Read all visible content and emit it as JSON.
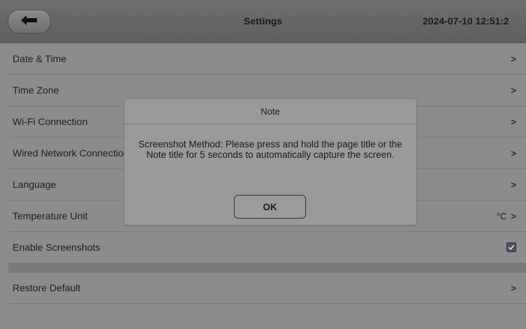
{
  "header": {
    "title": "Settings",
    "datetime": "2024-07-10 12:51:2",
    "back_icon": "back-arrow-icon"
  },
  "settings": [
    {
      "label": "Date & Time",
      "right": "",
      "control": "chevron"
    },
    {
      "label": "Time Zone",
      "right": "",
      "control": "chevron"
    },
    {
      "label": "Wi-Fi Connection",
      "right": "",
      "control": "chevron"
    },
    {
      "label": "Wired Network Connection",
      "right": "",
      "control": "chevron"
    },
    {
      "label": "Language",
      "right": "",
      "control": "chevron"
    },
    {
      "label": "Temperature Unit",
      "right": "°C",
      "control": "chevron"
    },
    {
      "label": "Enable Screenshots",
      "right": "",
      "control": "checkbox",
      "checked": true
    }
  ],
  "settings_group2": [
    {
      "label": "Restore Default",
      "control": "chevron"
    }
  ],
  "chevron": ">",
  "dialog": {
    "title": "Note",
    "message": "Screenshot Method: Please press and hold the page title or the Note title for 5 seconds to automatically capture the screen.",
    "ok_label": "OK"
  },
  "colors": {
    "background": "#8c8c8c",
    "topbar": "#666666",
    "dialog": "#9a9a9a",
    "checkbox": "#4b5563"
  }
}
